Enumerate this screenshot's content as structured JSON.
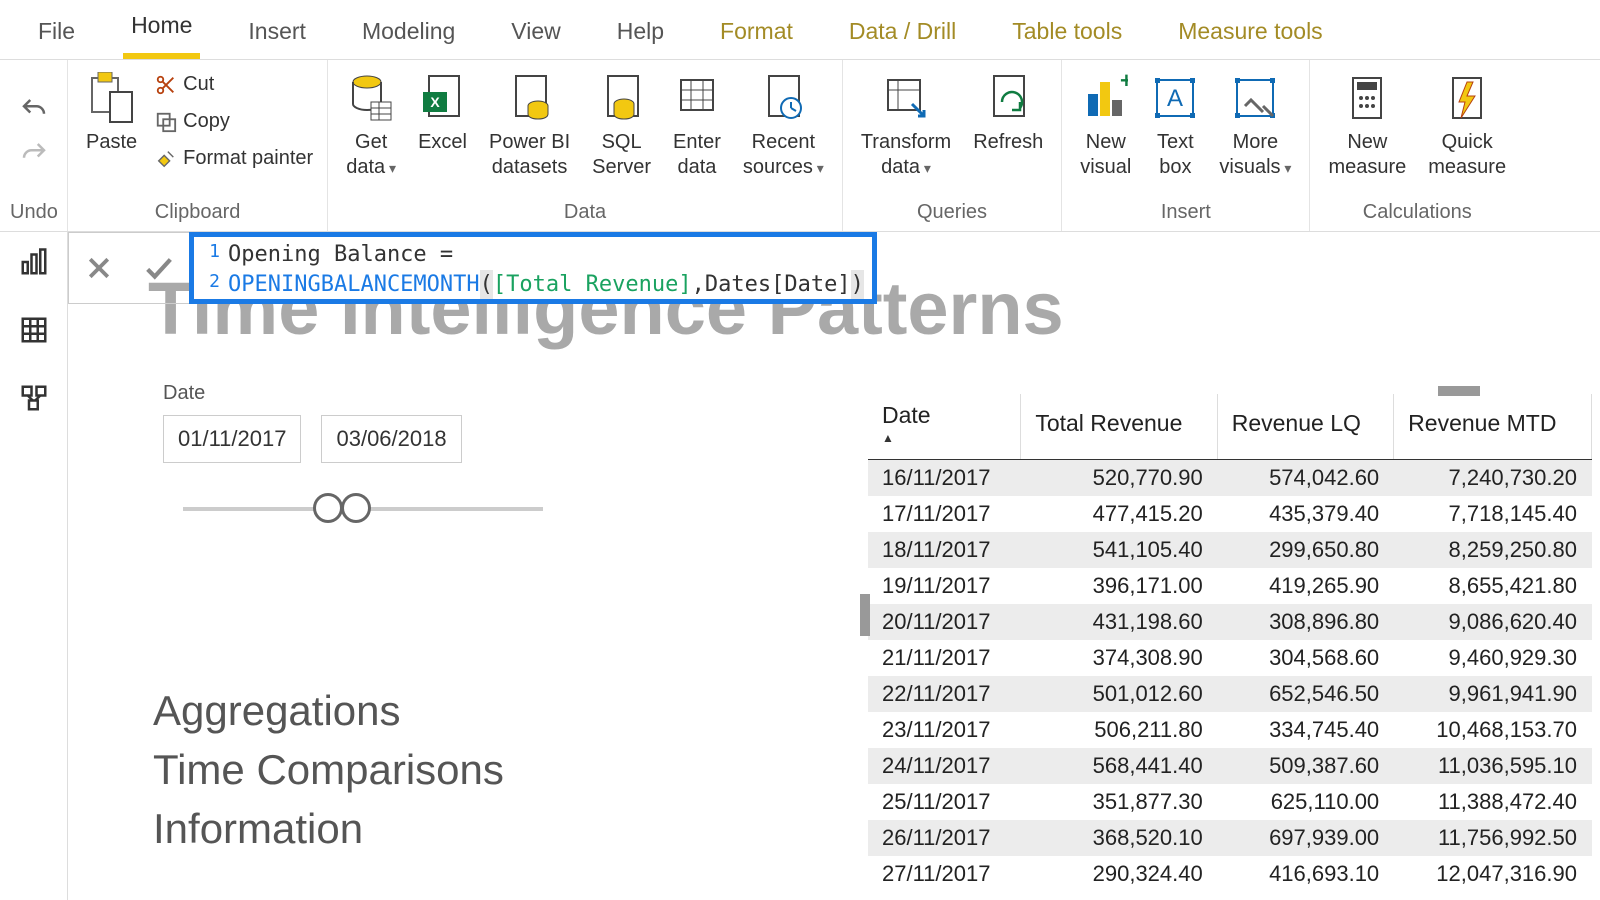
{
  "tabs": {
    "file": "File",
    "home": "Home",
    "insert": "Insert",
    "modeling": "Modeling",
    "view": "View",
    "help": "Help",
    "format": "Format",
    "datadrill": "Data / Drill",
    "tabletools": "Table tools",
    "measuretools": "Measure tools"
  },
  "ribbon": {
    "undo_group": "Undo",
    "clipboard": {
      "paste": "Paste",
      "cut": "Cut",
      "copy": "Copy",
      "format_painter": "Format painter",
      "group": "Clipboard"
    },
    "data": {
      "get_data": "Get\ndata",
      "excel": "Excel",
      "pbi_datasets": "Power BI\ndatasets",
      "sql_server": "SQL\nServer",
      "enter_data": "Enter\ndata",
      "recent_sources": "Recent\nsources",
      "group": "Data"
    },
    "queries": {
      "transform": "Transform\ndata",
      "refresh": "Refresh",
      "group": "Queries"
    },
    "insert": {
      "new_visual": "New\nvisual",
      "text_box": "Text\nbox",
      "more_visuals": "More\nvisuals",
      "group": "Insert"
    },
    "calculations": {
      "new_measure": "New\nmeasure",
      "quick_measure": "Quick\nmeasure",
      "group": "Calculations"
    }
  },
  "formula": {
    "line1": "Opening Balance =",
    "func": "OPENINGBALANCEMONTH",
    "open": "(",
    "arg1": " [Total Revenue]",
    "comma": ", ",
    "arg2": "Dates[Date] ",
    "close": ")"
  },
  "bg_title": "Time Intelligence Patterns",
  "slicer": {
    "label": "Date",
    "from": "01/11/2017",
    "to": "03/06/2018"
  },
  "headings": {
    "h1": "Aggregations",
    "h2": "Time Comparisons",
    "h3": "Information"
  },
  "table": {
    "headers": {
      "date": "Date",
      "rev": "Total Revenue",
      "lq": "Revenue LQ",
      "mtd": "Revenue MTD"
    },
    "rows": [
      {
        "date": "16/11/2017",
        "rev": "520,770.90",
        "lq": "574,042.60",
        "mtd": "7,240,730.20"
      },
      {
        "date": "17/11/2017",
        "rev": "477,415.20",
        "lq": "435,379.40",
        "mtd": "7,718,145.40"
      },
      {
        "date": "18/11/2017",
        "rev": "541,105.40",
        "lq": "299,650.80",
        "mtd": "8,259,250.80"
      },
      {
        "date": "19/11/2017",
        "rev": "396,171.00",
        "lq": "419,265.90",
        "mtd": "8,655,421.80"
      },
      {
        "date": "20/11/2017",
        "rev": "431,198.60",
        "lq": "308,896.80",
        "mtd": "9,086,620.40"
      },
      {
        "date": "21/11/2017",
        "rev": "374,308.90",
        "lq": "304,568.60",
        "mtd": "9,460,929.30"
      },
      {
        "date": "22/11/2017",
        "rev": "501,012.60",
        "lq": "652,546.50",
        "mtd": "9,961,941.90"
      },
      {
        "date": "23/11/2017",
        "rev": "506,211.80",
        "lq": "334,745.40",
        "mtd": "10,468,153.70"
      },
      {
        "date": "24/11/2017",
        "rev": "568,441.40",
        "lq": "509,387.60",
        "mtd": "11,036,595.10"
      },
      {
        "date": "25/11/2017",
        "rev": "351,877.30",
        "lq": "625,110.00",
        "mtd": "11,388,472.40"
      },
      {
        "date": "26/11/2017",
        "rev": "368,520.10",
        "lq": "697,939.00",
        "mtd": "11,756,992.50"
      },
      {
        "date": "27/11/2017",
        "rev": "290,324.40",
        "lq": "416,693.10",
        "mtd": "12,047,316.90"
      }
    ]
  }
}
